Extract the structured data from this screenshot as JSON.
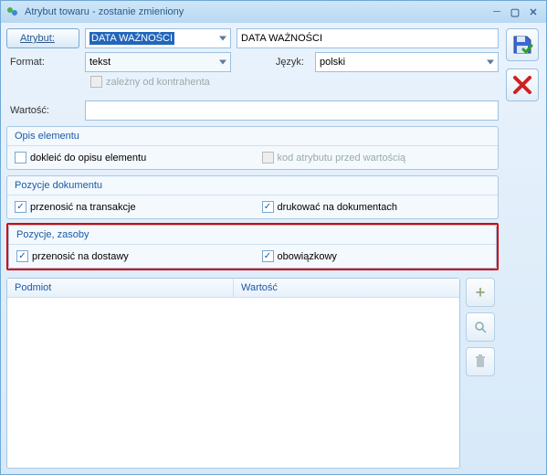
{
  "window": {
    "title": "Atrybut towaru - zostanie zmieniony"
  },
  "toolbar": {
    "attr_button": "Atrybut:",
    "attr_combo": "DATA WAŻNOŚCI",
    "attr_text": "DATA WAŻNOŚCI",
    "format_label": "Format:",
    "format_value": "tekst",
    "lang_label": "Język:",
    "lang_value": "polski",
    "dep_checkbox": "zależny od kontrahenta",
    "wartosc_label": "Wartość:"
  },
  "groups": {
    "opis": {
      "title": "Opis elementu",
      "cb1": "dokleić do opisu elementu",
      "cb2": "kod atrybutu przed wartością"
    },
    "pozdoc": {
      "title": "Pozycje dokumentu",
      "cb1": "przenosić na transakcje",
      "cb2": "drukować na dokumentach"
    },
    "pozzas": {
      "title": "Pozycje, zasoby",
      "cb1": "przenosić na dostawy",
      "cb2": "obowiązkowy"
    }
  },
  "table": {
    "col1": "Podmiot",
    "col2": "Wartość"
  }
}
